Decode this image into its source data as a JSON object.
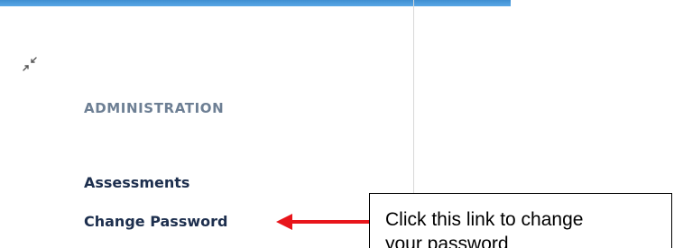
{
  "colors": {
    "top_bar": "#4a9bdc",
    "heading": "#6d7f94",
    "link": "#1d2f4e",
    "arrow": "#e8151b",
    "divider": "#d8d8d8"
  },
  "icons": {
    "collapse": "collapse-arrows-icon"
  },
  "sidebar": {
    "section_heading": "ADMINISTRATION",
    "items": [
      {
        "label": "Assessments"
      },
      {
        "label": "Change Password"
      }
    ]
  },
  "callout": {
    "line1": "Click this link to change",
    "line2": "your password"
  }
}
